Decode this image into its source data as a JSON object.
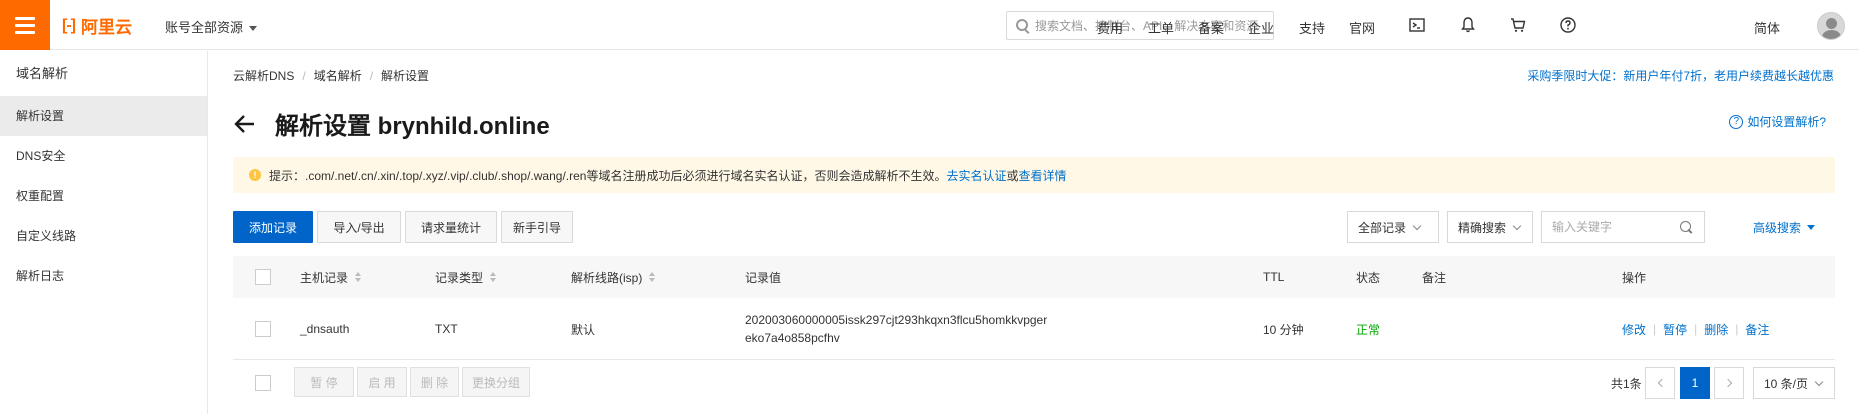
{
  "header": {
    "logo_text": "阿里云",
    "account_label": "账号全部资源",
    "search_placeholder": "搜索文档、控制台、API、解决方案和资源",
    "nav": [
      "费用",
      "工单",
      "备案",
      "企业",
      "支持",
      "官网"
    ],
    "lang": "简体",
    "icons": [
      "terminal-icon",
      "bell-icon",
      "cart-icon",
      "help-icon"
    ]
  },
  "sidebar": {
    "title": "域名解析",
    "items": [
      {
        "label": "解析设置",
        "active": true
      },
      {
        "label": "DNS安全"
      },
      {
        "label": "权重配置"
      },
      {
        "label": "自定义线路"
      },
      {
        "label": "解析日志"
      }
    ]
  },
  "breadcrumb": [
    "云解析DNS",
    "域名解析",
    "解析设置"
  ],
  "promo": "采购季限时大促：新用户年付7折，老用户续费越长越优惠",
  "page_title": "解析设置 brynhild.online",
  "help_link": "如何设置解析?",
  "notice": {
    "text": "提示：.com/.net/.cn/.xin/.top/.xyz/.vip/.club/.shop/.wang/.ren等域名注册成功后必须进行域名实名认证，否则会造成解析不生效。",
    "link1": "去实名认证",
    "joiner": "或",
    "link2": "查看详情"
  },
  "toolbar": {
    "add": "添加记录",
    "import_export": "导入/导出",
    "stats": "请求量统计",
    "guide": "新手引导",
    "filter": "全部记录",
    "search_mode": "精确搜索",
    "keyword_placeholder": "输入关键字",
    "advanced": "高级搜索"
  },
  "table": {
    "headers": {
      "host": "主机记录",
      "type": "记录类型",
      "line": "解析线路(isp)",
      "value": "记录值",
      "ttl": "TTL",
      "status": "状态",
      "remark": "备注",
      "action": "操作"
    },
    "rows": [
      {
        "host": "_dnsauth",
        "type": "TXT",
        "line": "默认",
        "value": "202003060000005issk297cjt293hkqxn3flcu5homkkvpgereko7a4o858pcfhv",
        "ttl": "10 分钟",
        "status": "正常",
        "remark": "",
        "actions": [
          "修改",
          "暂停",
          "删除",
          "备注"
        ]
      }
    ]
  },
  "footer": {
    "bulk": [
      "暂 停",
      "启 用",
      "删 除",
      "更换分组"
    ],
    "total": "共1条",
    "current_page": "1",
    "page_size": "10 条/页"
  }
}
